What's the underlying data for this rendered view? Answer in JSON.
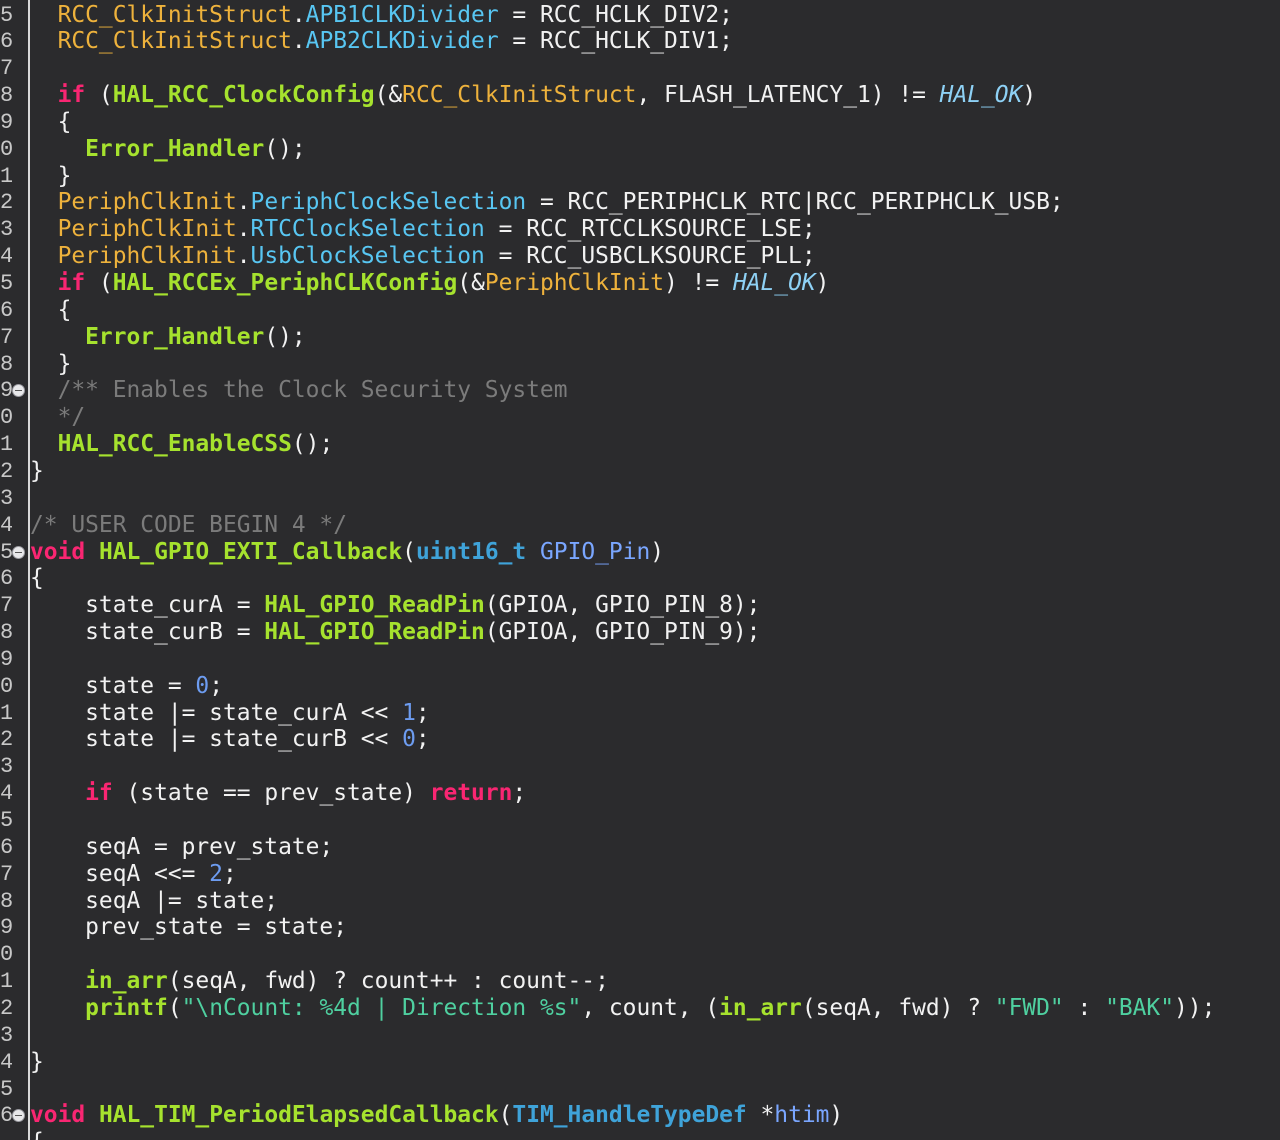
{
  "editor": {
    "colors": {
      "background": "#2b2b2d",
      "gutter_border": "#d9d9d9",
      "line_numbers": "#c8c8c8"
    },
    "gutter": [
      {
        "n": "5"
      },
      {
        "n": "6"
      },
      {
        "n": "7"
      },
      {
        "n": "8"
      },
      {
        "n": "9"
      },
      {
        "n": "0"
      },
      {
        "n": "1"
      },
      {
        "n": "2"
      },
      {
        "n": "3"
      },
      {
        "n": "4"
      },
      {
        "n": "5"
      },
      {
        "n": "6"
      },
      {
        "n": "7"
      },
      {
        "n": "8"
      },
      {
        "n": "9",
        "fold": true
      },
      {
        "n": "0"
      },
      {
        "n": "1"
      },
      {
        "n": "2"
      },
      {
        "n": "3"
      },
      {
        "n": "4"
      },
      {
        "n": "5",
        "fold": true
      },
      {
        "n": "6"
      },
      {
        "n": "7"
      },
      {
        "n": "8"
      },
      {
        "n": "9"
      },
      {
        "n": "0"
      },
      {
        "n": "1"
      },
      {
        "n": "2"
      },
      {
        "n": "3"
      },
      {
        "n": "4"
      },
      {
        "n": "5"
      },
      {
        "n": "6"
      },
      {
        "n": "7"
      },
      {
        "n": "8"
      },
      {
        "n": "9"
      },
      {
        "n": "0"
      },
      {
        "n": "1"
      },
      {
        "n": "2"
      },
      {
        "n": "3"
      },
      {
        "n": "4"
      },
      {
        "n": "5"
      },
      {
        "n": "6",
        "fold": true
      },
      {
        "n": ""
      }
    ],
    "lines": [
      [
        [
          "  ",
          "plain"
        ],
        [
          "RCC_ClkInitStruct",
          "struct"
        ],
        [
          ".",
          "plain"
        ],
        [
          "APB1CLKDivider",
          "field"
        ],
        [
          " = RCC_HCLK_DIV2;",
          "plain"
        ]
      ],
      [
        [
          "  ",
          "plain"
        ],
        [
          "RCC_ClkInitStruct",
          "struct"
        ],
        [
          ".",
          "plain"
        ],
        [
          "APB2CLKDivider",
          "field"
        ],
        [
          " = RCC_HCLK_DIV1;",
          "plain"
        ]
      ],
      [],
      [
        [
          "  ",
          "plain"
        ],
        [
          "if",
          "kw"
        ],
        [
          " (",
          "plain"
        ],
        [
          "HAL_RCC_ClockConfig",
          "func"
        ],
        [
          "(&",
          "plain"
        ],
        [
          "RCC_ClkInitStruct",
          "struct"
        ],
        [
          ", FLASH_LATENCY_1) != ",
          "plain"
        ],
        [
          "HAL_OK",
          "const"
        ],
        [
          ")",
          "plain"
        ]
      ],
      [
        [
          "  {",
          "plain"
        ]
      ],
      [
        [
          "    ",
          "plain"
        ],
        [
          "Error_Handler",
          "func"
        ],
        [
          "();",
          "plain"
        ]
      ],
      [
        [
          "  }",
          "plain"
        ]
      ],
      [
        [
          "  ",
          "plain"
        ],
        [
          "PeriphClkInit",
          "struct"
        ],
        [
          ".",
          "plain"
        ],
        [
          "PeriphClockSelection",
          "field"
        ],
        [
          " = RCC_PERIPHCLK_RTC|RCC_PERIPHCLK_USB;",
          "plain"
        ]
      ],
      [
        [
          "  ",
          "plain"
        ],
        [
          "PeriphClkInit",
          "struct"
        ],
        [
          ".",
          "plain"
        ],
        [
          "RTCClockSelection",
          "field"
        ],
        [
          " = RCC_RTCCLKSOURCE_LSE;",
          "plain"
        ]
      ],
      [
        [
          "  ",
          "plain"
        ],
        [
          "PeriphClkInit",
          "struct"
        ],
        [
          ".",
          "plain"
        ],
        [
          "UsbClockSelection",
          "field"
        ],
        [
          " = RCC_USBCLKSOURCE_PLL;",
          "plain"
        ]
      ],
      [
        [
          "  ",
          "plain"
        ],
        [
          "if",
          "kw"
        ],
        [
          " (",
          "plain"
        ],
        [
          "HAL_RCCEx_PeriphCLKConfig",
          "func"
        ],
        [
          "(&",
          "plain"
        ],
        [
          "PeriphClkInit",
          "struct"
        ],
        [
          ") != ",
          "plain"
        ],
        [
          "HAL_OK",
          "const"
        ],
        [
          ")",
          "plain"
        ]
      ],
      [
        [
          "  {",
          "plain"
        ]
      ],
      [
        [
          "    ",
          "plain"
        ],
        [
          "Error_Handler",
          "func"
        ],
        [
          "();",
          "plain"
        ]
      ],
      [
        [
          "  }",
          "plain"
        ]
      ],
      [
        [
          "  ",
          "plain"
        ],
        [
          "/** Enables the Clock Security System",
          "comment"
        ]
      ],
      [
        [
          "  ",
          "plain"
        ],
        [
          "*/",
          "comment"
        ]
      ],
      [
        [
          "  ",
          "plain"
        ],
        [
          "HAL_RCC_EnableCSS",
          "func"
        ],
        [
          "();",
          "plain"
        ]
      ],
      [
        [
          "}",
          "plain"
        ]
      ],
      [],
      [
        [
          "/* USER CODE BEGIN 4 */",
          "comment"
        ]
      ],
      [
        [
          "void",
          "decl"
        ],
        [
          " ",
          "plain"
        ],
        [
          "HAL_GPIO_EXTI_Callback",
          "func"
        ],
        [
          "(",
          "plain"
        ],
        [
          "uint16_t",
          "type"
        ],
        [
          " ",
          "plain"
        ],
        [
          "GPIO_Pin",
          "param"
        ],
        [
          ")",
          "plain"
        ]
      ],
      [
        [
          "{",
          "plain"
        ]
      ],
      [
        [
          "    state_curA = ",
          "plain"
        ],
        [
          "HAL_GPIO_ReadPin",
          "func"
        ],
        [
          "(GPIOA, GPIO_PIN_8);",
          "plain"
        ]
      ],
      [
        [
          "    state_curB = ",
          "plain"
        ],
        [
          "HAL_GPIO_ReadPin",
          "func"
        ],
        [
          "(GPIOA, GPIO_PIN_9);",
          "plain"
        ]
      ],
      [],
      [
        [
          "    state = ",
          "plain"
        ],
        [
          "0",
          "num"
        ],
        [
          ";",
          "plain"
        ]
      ],
      [
        [
          "    state |= state_curA << ",
          "plain"
        ],
        [
          "1",
          "num"
        ],
        [
          ";",
          "plain"
        ]
      ],
      [
        [
          "    state |= state_curB << ",
          "plain"
        ],
        [
          "0",
          "num"
        ],
        [
          ";",
          "plain"
        ]
      ],
      [],
      [
        [
          "    ",
          "plain"
        ],
        [
          "if",
          "kw"
        ],
        [
          " (state == prev_state) ",
          "plain"
        ],
        [
          "return",
          "kw"
        ],
        [
          ";",
          "plain"
        ]
      ],
      [],
      [
        [
          "    seqA = prev_state;",
          "plain"
        ]
      ],
      [
        [
          "    seqA <<= ",
          "plain"
        ],
        [
          "2",
          "num"
        ],
        [
          ";",
          "plain"
        ]
      ],
      [
        [
          "    seqA |= state;",
          "plain"
        ]
      ],
      [
        [
          "    prev_state = state;",
          "plain"
        ]
      ],
      [],
      [
        [
          "    ",
          "plain"
        ],
        [
          "in_arr",
          "func"
        ],
        [
          "(seqA, fwd) ? count++ : count--;",
          "plain"
        ]
      ],
      [
        [
          "    ",
          "plain"
        ],
        [
          "printf",
          "func"
        ],
        [
          "(",
          "plain"
        ],
        [
          "\"\\nCount: %4d | Direction %s\"",
          "str"
        ],
        [
          ", count, (",
          "plain"
        ],
        [
          "in_arr",
          "func"
        ],
        [
          "(seqA, fwd) ? ",
          "plain"
        ],
        [
          "\"FWD\"",
          "str"
        ],
        [
          " : ",
          "plain"
        ],
        [
          "\"BAK\"",
          "str"
        ],
        [
          "));",
          "plain"
        ]
      ],
      [],
      [
        [
          "}",
          "plain"
        ]
      ],
      [],
      [
        [
          "void",
          "decl"
        ],
        [
          " ",
          "plain"
        ],
        [
          "HAL_TIM_PeriodElapsedCallback",
          "func"
        ],
        [
          "(",
          "plain"
        ],
        [
          "TIM_HandleTypeDef",
          "type"
        ],
        [
          " *",
          "plain"
        ],
        [
          "htim",
          "param"
        ],
        [
          ")",
          "plain"
        ]
      ],
      [
        [
          "{",
          "plain"
        ]
      ]
    ]
  }
}
